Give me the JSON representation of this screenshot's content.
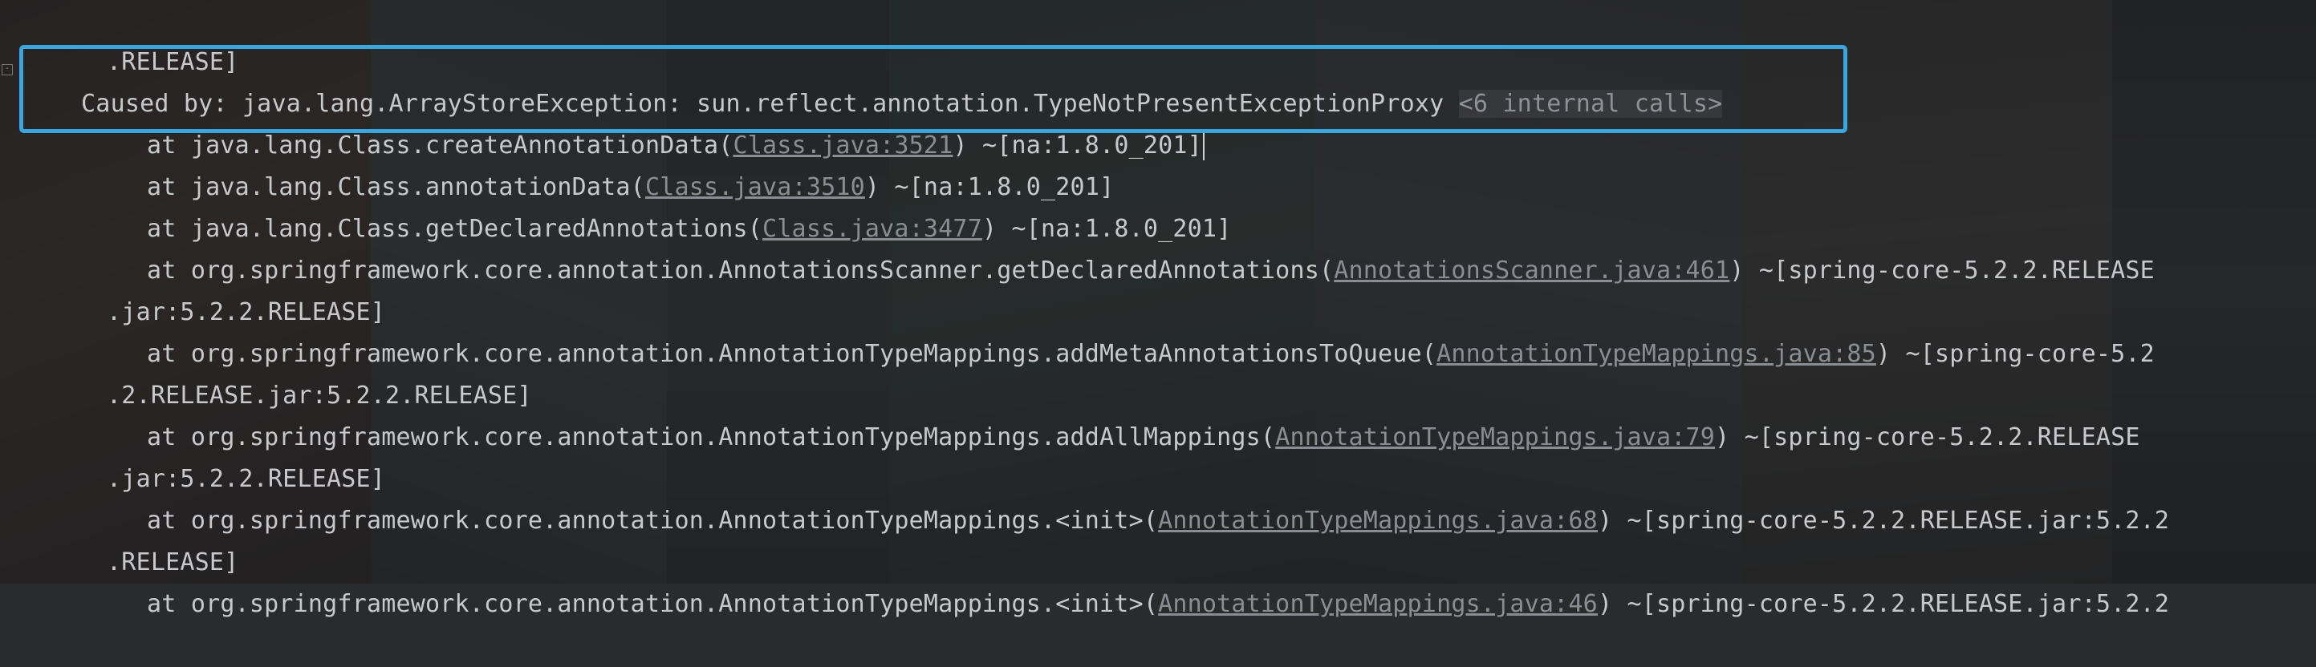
{
  "console": {
    "lines": [
      {
        "prefix": ".RELEASE]"
      },
      {
        "prefix": "Caused by: java.lang.ArrayStoreException: sun.reflect.annotation.TypeNotPresentExceptionProxy ",
        "internal": "<6 internal calls>"
      },
      {
        "prefix": "at java.lang.Class.createAnnotationData(",
        "link": "Class.java:3521",
        "suffix": ") ~[na:1.8.0_201]"
      },
      {
        "prefix": "at java.lang.Class.annotationData(",
        "link": "Class.java:3510",
        "suffix": ") ~[na:1.8.0_201]"
      },
      {
        "prefix": "at java.lang.Class.getDeclaredAnnotations(",
        "link": "Class.java:3477",
        "suffix": ") ~[na:1.8.0_201]"
      },
      {
        "prefix": "at org.springframework.core.annotation.AnnotationsScanner.getDeclaredAnnotations(",
        "link": "AnnotationsScanner.java:461",
        "suffix": ") ~[spring-core-5.2.2.RELEASE"
      },
      {
        "prefix": ".jar:5.2.2.RELEASE]"
      },
      {
        "prefix": "at org.springframework.core.annotation.AnnotationTypeMappings.addMetaAnnotationsToQueue(",
        "link": "AnnotationTypeMappings.java:85",
        "suffix": ") ~[spring-core-5.2"
      },
      {
        "prefix": ".2.RELEASE.jar:5.2.2.RELEASE]"
      },
      {
        "prefix": "at org.springframework.core.annotation.AnnotationTypeMappings.addAllMappings(",
        "link": "AnnotationTypeMappings.java:79",
        "suffix": ") ~[spring-core-5.2.2.RELEASE"
      },
      {
        "prefix": ".jar:5.2.2.RELEASE]"
      },
      {
        "prefix": "at org.springframework.core.annotation.AnnotationTypeMappings.<init>(",
        "link": "AnnotationTypeMappings.java:68",
        "suffix": ") ~[spring-core-5.2.2.RELEASE.jar:5.2.2"
      },
      {
        "prefix": ".RELEASE]"
      },
      {
        "prefix": "at org.springframework.core.annotation.AnnotationTypeMappings.<init>(",
        "link": "AnnotationTypeMappings.java:46",
        "suffix": ") ~[spring-core-5.2.2.RELEASE.jar:5.2.2"
      }
    ]
  },
  "fold_marker": "-",
  "colors": {
    "text": "#c8c9cc",
    "link": "#8a8d92",
    "highlight_border": "#3aa5de"
  }
}
